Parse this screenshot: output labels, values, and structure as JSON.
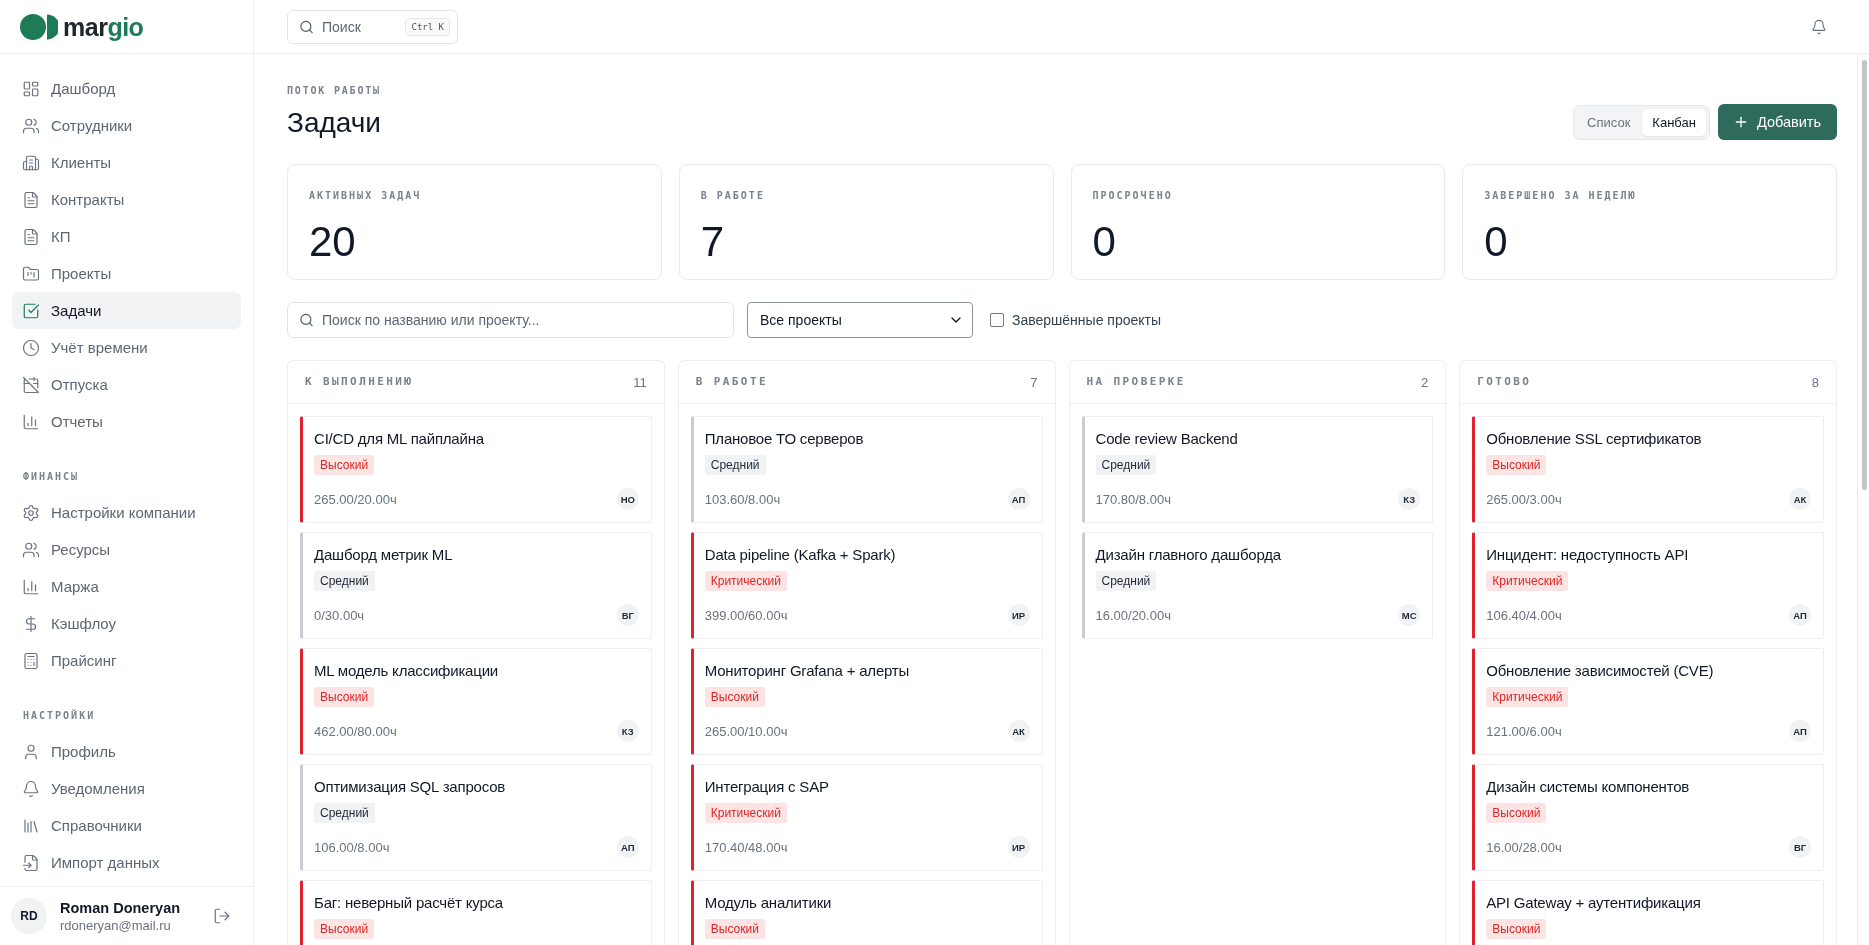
{
  "sidebar": {
    "logo": {
      "wordmark": [
        "mar",
        "gio"
      ]
    },
    "sections": [
      {
        "items": [
          {
            "label": "Дашборд",
            "selected": false
          },
          {
            "label": "Сотрудники",
            "selected": false
          },
          {
            "label": "Клиенты",
            "selected": false
          },
          {
            "label": "Контракты",
            "selected": false
          },
          {
            "label": "КП",
            "selected": false
          },
          {
            "label": "Проекты",
            "selected": false
          },
          {
            "label": "Задачи",
            "selected": true
          },
          {
            "label": "Учёт времени",
            "selected": false
          },
          {
            "label": "Отпуска",
            "selected": false
          },
          {
            "label": "Отчеты",
            "selected": false
          }
        ]
      },
      {
        "title": "ФИНАНСЫ",
        "items": [
          {
            "label": "Настройки компании",
            "selected": false
          },
          {
            "label": "Ресурсы",
            "selected": false
          },
          {
            "label": "Маржа",
            "selected": false
          },
          {
            "label": "Кэшфлоу",
            "selected": false
          },
          {
            "label": "Прайсинг",
            "selected": false
          }
        ]
      },
      {
        "title": "НАСТРОЙКИ",
        "items": [
          {
            "label": "Профиль",
            "selected": false
          },
          {
            "label": "Уведомления",
            "selected": false
          },
          {
            "label": "Справочники",
            "selected": false
          },
          {
            "label": "Импорт данных",
            "selected": false
          }
        ]
      }
    ],
    "user": {
      "initials": "RD",
      "name": "Roman Doneryan",
      "email": "rdoneryan@mail.ru"
    }
  },
  "header": {
    "search": {
      "placeholder": "Поиск",
      "shortcut": "Ctrl K"
    }
  },
  "page": {
    "eyebrow": "ПОТОК РАБОТЫ",
    "title": "Задачи",
    "view_toggle": [
      {
        "label": "Список",
        "selected": false
      },
      {
        "label": "Канбан",
        "selected": true
      }
    ],
    "add_button": "Добавить"
  },
  "stats": [
    {
      "label": "АКТИВНЫХ ЗАДАЧ",
      "value": "20"
    },
    {
      "label": "В РАБОТЕ",
      "value": "7"
    },
    {
      "label": "ПРОСРОЧЕНО",
      "value": "0"
    },
    {
      "label": "ЗАВЕРШЕНО ЗА НЕДЕЛЮ",
      "value": "0"
    }
  ],
  "filters": {
    "search": {
      "placeholder": "Поиск по названию или проекту..."
    },
    "project_select": {
      "value": "Все проекты"
    },
    "completed_projects": {
      "label": "Завершённые проекты",
      "checked": false
    }
  },
  "columns": [
    {
      "title": "К ВЫПОЛНЕНИЮ",
      "count": "11",
      "tasks": [
        {
          "title": "CI/CD для ML пайплайна",
          "priority": "Высокий",
          "kind": "urgent",
          "hours": "265.00/20.00ч",
          "assignee": "НО"
        },
        {
          "title": "Дашборд метрик ML",
          "priority": "Средний",
          "kind": "normal",
          "hours": "0/30.00ч",
          "assignee": "ВГ"
        },
        {
          "title": "ML модель классификации",
          "priority": "Высокий",
          "kind": "urgent",
          "hours": "462.00/80.00ч",
          "assignee": "КЗ"
        },
        {
          "title": "Оптимизация SQL запросов",
          "priority": "Средний",
          "kind": "normal",
          "hours": "106.00/8.00ч",
          "assignee": "АП"
        },
        {
          "title": "Баг: неверный расчёт курса",
          "priority": "Высокий",
          "kind": "urgent"
        }
      ]
    },
    {
      "title": "В РАБОТЕ",
      "count": "7",
      "tasks": [
        {
          "title": "Плановое ТО серверов",
          "priority": "Средний",
          "kind": "normal",
          "hours": "103.60/8.00ч",
          "assignee": "АП"
        },
        {
          "title": "Data pipeline (Kafka + Spark)",
          "priority": "Критический",
          "kind": "urgent",
          "hours": "399.00/60.00ч",
          "assignee": "ИР"
        },
        {
          "title": "Мониторинг Grafana + алерты",
          "priority": "Высокий",
          "kind": "urgent",
          "hours": "265.00/10.00ч",
          "assignee": "АК"
        },
        {
          "title": "Интеграция с SAP",
          "priority": "Критический",
          "kind": "urgent",
          "hours": "170.40/48.00ч",
          "assignee": "ИР"
        },
        {
          "title": "Модуль аналитики",
          "priority": "Высокий",
          "kind": "urgent"
        }
      ]
    },
    {
      "title": "НА ПРОВЕРКЕ",
      "count": "2",
      "tasks": [
        {
          "title": "Code review Backend",
          "priority": "Средний",
          "kind": "normal",
          "hours": "170.80/8.00ч",
          "assignee": "КЗ"
        },
        {
          "title": "Дизайн главного дашборда",
          "priority": "Средний",
          "kind": "normal",
          "hours": "16.00/20.00ч",
          "assignee": "МС"
        }
      ]
    },
    {
      "title": "ГОТОВО",
      "count": "8",
      "tasks": [
        {
          "title": "Обновление SSL сертификатов",
          "priority": "Высокий",
          "kind": "urgent",
          "hours": "265.00/3.00ч",
          "assignee": "АК"
        },
        {
          "title": "Инцидент: недоступность API",
          "priority": "Критический",
          "kind": "urgent",
          "hours": "106.40/4.00ч",
          "assignee": "АП"
        },
        {
          "title": "Обновление зависимостей (CVE)",
          "priority": "Критический",
          "kind": "urgent",
          "hours": "121.00/6.00ч",
          "assignee": "АП"
        },
        {
          "title": "Дизайн системы компонентов",
          "priority": "Высокий",
          "kind": "urgent",
          "hours": "16.00/28.00ч",
          "assignee": "ВГ"
        },
        {
          "title": "API Gateway + аутентификация",
          "priority": "Высокий",
          "kind": "urgent"
        }
      ]
    }
  ]
}
